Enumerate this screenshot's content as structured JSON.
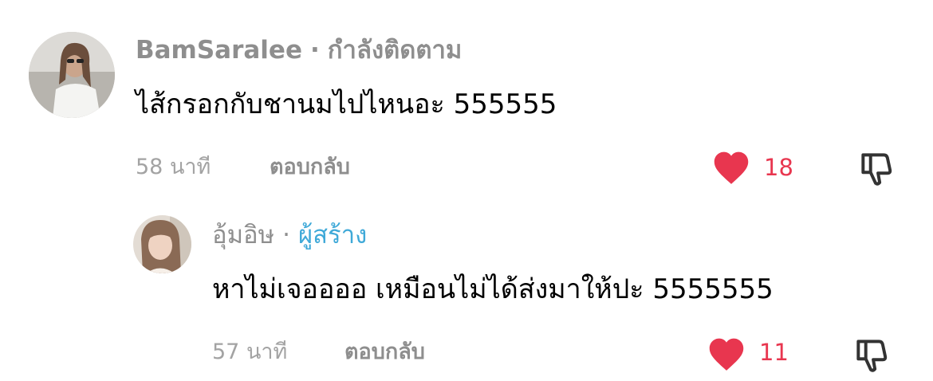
{
  "comment": {
    "username": "BamSaralee",
    "separator": "·",
    "status": "กำลังติดตาม",
    "text": "ไส้กรอกกับชานมไปไหนอะ 555555",
    "time": "58 นาที",
    "reply_label": "ตอบกลับ",
    "like_count": "18",
    "icons": {
      "like": "heart-icon",
      "dislike": "thumbs-down-icon"
    }
  },
  "reply": {
    "username": "อุ้มอิษ",
    "separator": "·",
    "badge": "ผู้สร้าง",
    "text": "หาไม่เจออออ เหมือนไม่ได้ส่งมาให้ปะ 5555555",
    "time": "57 นาที",
    "reply_label": "ตอบกลับ",
    "like_count": "11",
    "icons": {
      "like": "heart-icon",
      "dislike": "thumbs-down-icon"
    }
  },
  "colors": {
    "username": "#8e8e8e",
    "creator_badge": "#3fa9d8",
    "like": "#e8364f",
    "timestamp": "#a3a3a3"
  }
}
